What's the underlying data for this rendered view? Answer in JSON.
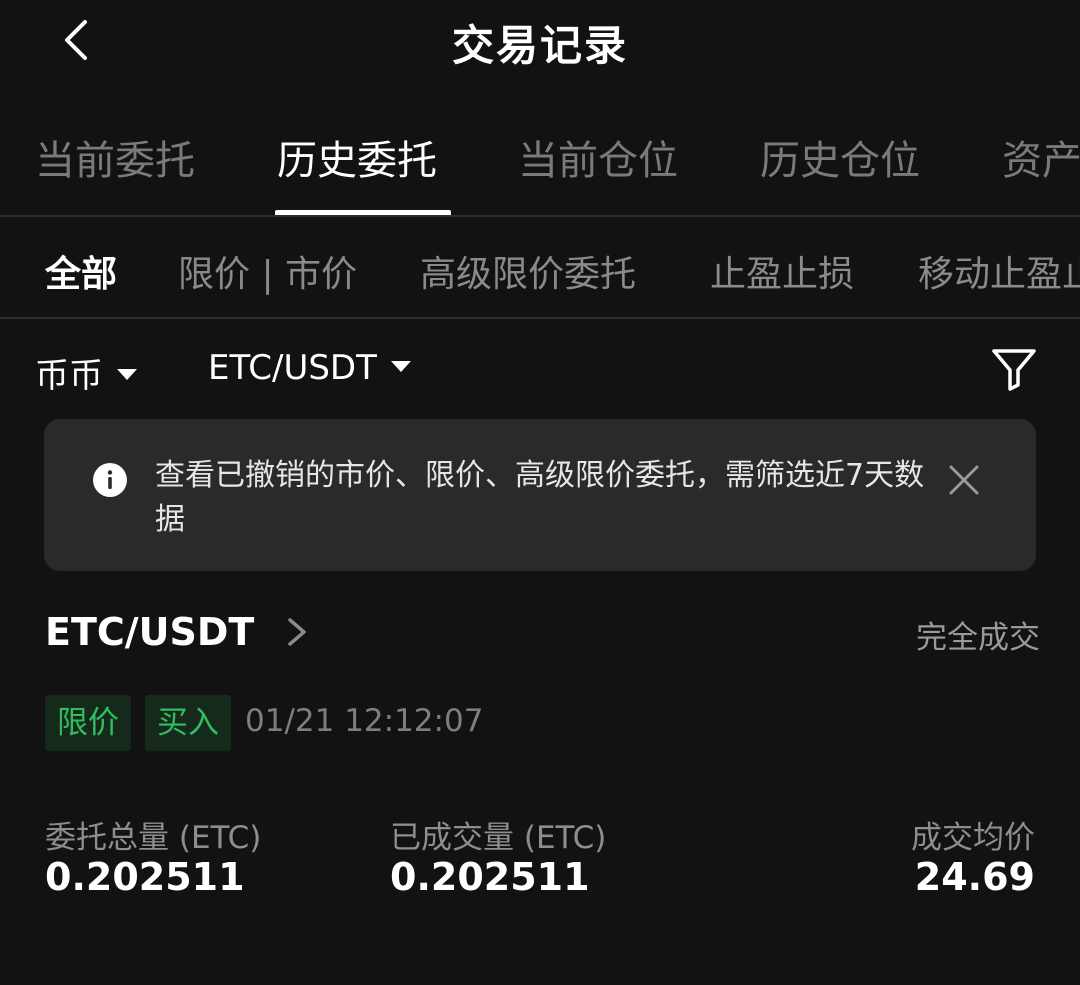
{
  "header": {
    "title": "交易记录",
    "back_icon": "chevron-left-icon"
  },
  "tabs": [
    {
      "label": "当前委托",
      "active": false
    },
    {
      "label": "历史委托",
      "active": true
    },
    {
      "label": "当前仓位",
      "active": false
    },
    {
      "label": "历史仓位",
      "active": false
    },
    {
      "label": "资产",
      "active": false
    }
  ],
  "subtabs": [
    {
      "label": "全部",
      "active": true
    },
    {
      "label": "限价 | 市价",
      "active": false
    },
    {
      "label": "高级限价委托",
      "active": false
    },
    {
      "label": "止盈止损",
      "active": false
    },
    {
      "label": "移动止盈止损",
      "active": false
    }
  ],
  "filters": {
    "market": "币币",
    "pair": "ETC/USDT",
    "filter_icon": "filter-funnel-icon"
  },
  "notice": {
    "text": "查看已撤销的市价、限价、高级限价委托，需筛选近7天数据",
    "info_icon": "info-icon",
    "close_icon": "close-icon"
  },
  "order": {
    "pair": "ETC/USDT",
    "status": "完全成交",
    "order_type": "限价",
    "side": "买入",
    "time": "01/21 12:12:07",
    "total_label": "委托总量 (ETC)",
    "total_value": "0.202511",
    "filled_label": "已成交量 (ETC)",
    "filled_value": "0.202511",
    "avg_label": "成交均价",
    "avg_value": "24.69"
  },
  "colors": {
    "background": "#121212",
    "panel": "#2a2a2a",
    "buy_green": "#2fbf62",
    "inactive_text": "#7a7a7a"
  }
}
